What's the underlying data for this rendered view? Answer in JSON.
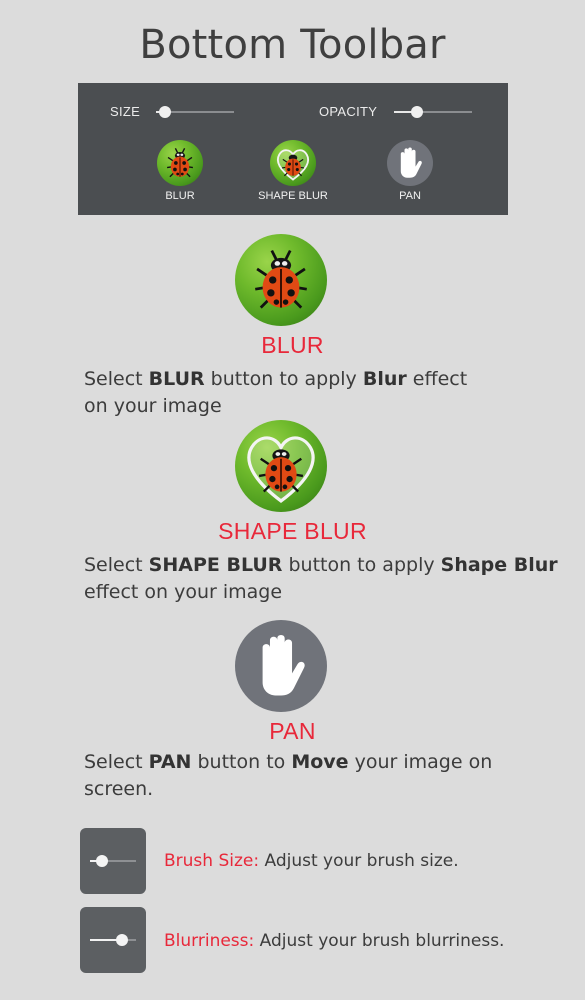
{
  "title": "Bottom Toolbar",
  "toolbar": {
    "size_label": "SIZE",
    "size_level": 0.12,
    "opacity_label": "OPACITY",
    "opacity_level": 0.3,
    "buttons": [
      {
        "label": "BLUR",
        "icon": "ladybug-icon"
      },
      {
        "label": "SHAPE BLUR",
        "icon": "heart-ladybug-icon"
      },
      {
        "label": "PAN",
        "icon": "hand-icon"
      }
    ]
  },
  "sections": {
    "blur": {
      "heading": "BLUR",
      "pre": "Select ",
      "b1": "BLUR",
      "mid": " button to apply ",
      "b2": "Blur",
      "post": " effect on your image"
    },
    "shape_blur": {
      "heading": "SHAPE BLUR",
      "pre": "Select ",
      "b1": "SHAPE BLUR",
      "mid": " button to apply ",
      "b2": "Shape Blur",
      "post": " effect on your image"
    },
    "pan": {
      "heading": "PAN",
      "pre": "Select ",
      "b1": "PAN",
      "mid": " button to ",
      "b2": "Move",
      "post": " your image on screen."
    }
  },
  "settings": [
    {
      "key": "Brush Size:",
      "text": " Adjust your brush size.",
      "level": 0.25
    },
    {
      "key": "Blurriness:",
      "text": " Adjust your brush blurriness.",
      "level": 0.7
    }
  ],
  "colors": {
    "accent_red": "#e8283a",
    "toolbar_bg": "#4b4e51",
    "page_bg": "#dcdcdc"
  }
}
